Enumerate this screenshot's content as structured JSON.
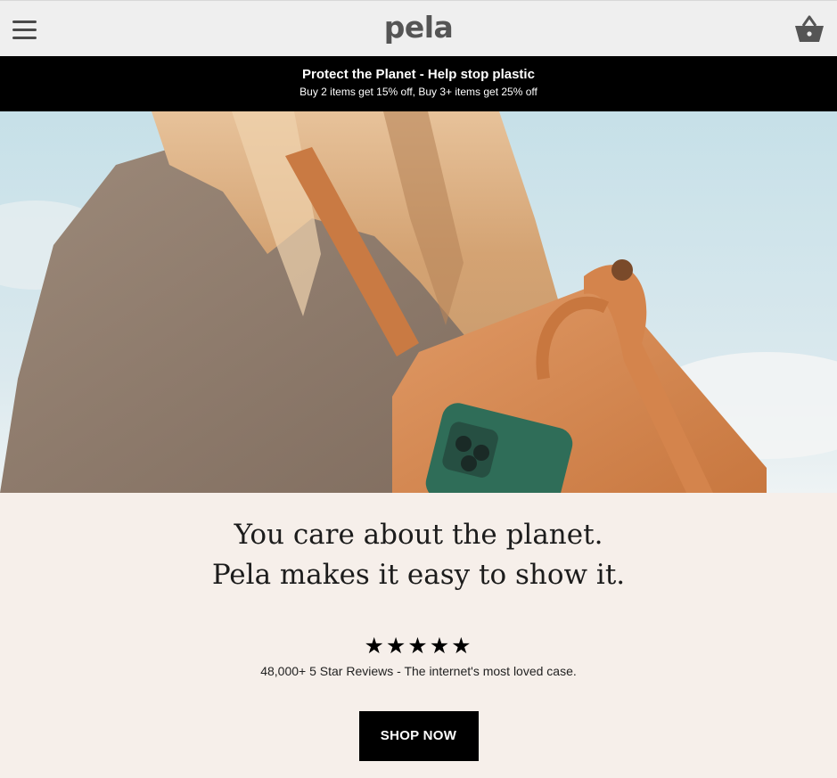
{
  "header": {
    "logo": "pela",
    "menu_icon": "hamburger-menu-icon",
    "cart_icon": "shopping-basket-icon"
  },
  "promo": {
    "title": "Protect the Planet - Help stop plastic",
    "subtitle": "Buy 2 items get 15% off, Buy 3+ items get 25% off"
  },
  "hero": {
    "image": "woman with long blonde hair wearing an orange backpack holding a green phone case"
  },
  "main": {
    "headline_line1": "You care about the planet.",
    "headline_line2": "Pela makes it easy to show it.",
    "stars": "★★★★★",
    "rating_value": 5,
    "reviews": "48,000+ 5 Star Reviews - The internet's most loved case.",
    "cta_label": "SHOP NOW"
  },
  "colors": {
    "header_bg": "#efefef",
    "promo_bg": "#000000",
    "page_bg": "#f6efea",
    "cta_bg": "#000000",
    "logo": "#555555"
  }
}
